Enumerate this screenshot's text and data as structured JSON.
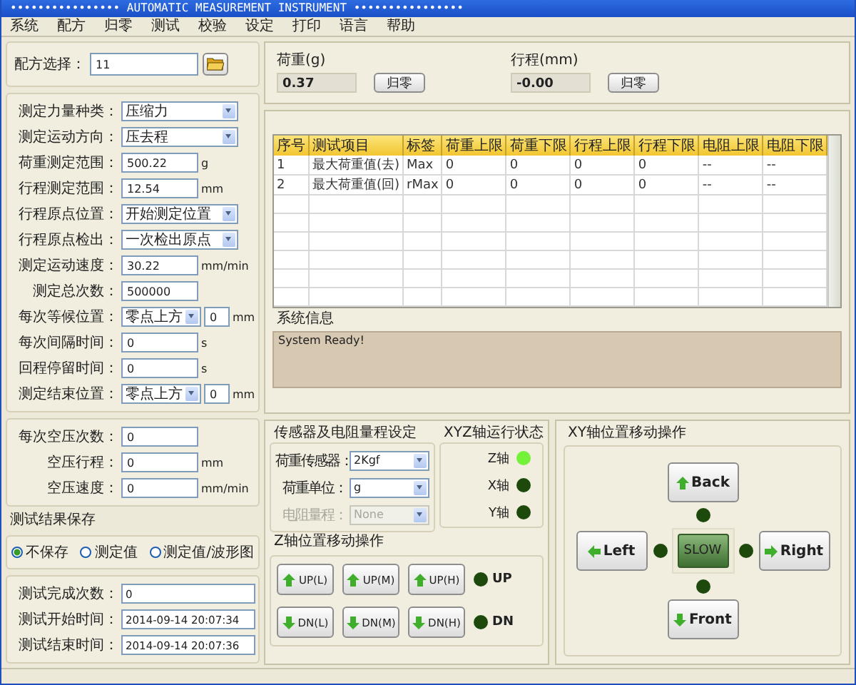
{
  "window": {
    "title": "•••••••••••••••• AUTOMATIC MEASUREMENT INSTRUMENT ••••••••••••••••"
  },
  "menu": [
    "系统",
    "配方",
    "归零",
    "测试",
    "校验",
    "设定",
    "打印",
    "语言",
    "帮助"
  ],
  "recipe": {
    "label": "配方选择：",
    "value": "11"
  },
  "params": [
    {
      "kind": "select",
      "label": "测定力量种类：",
      "value": "压缩力"
    },
    {
      "kind": "select",
      "label": "测定运动方向：",
      "value": "压去程"
    },
    {
      "kind": "input",
      "label": "荷重测定范围：",
      "value": "500.22",
      "unit": "g"
    },
    {
      "kind": "input",
      "label": "行程测定范围：",
      "value": "12.54",
      "unit": "mm"
    },
    {
      "kind": "select",
      "label": "行程原点位置：",
      "value": "开始测定位置"
    },
    {
      "kind": "select",
      "label": "行程原点检出：",
      "value": "一次检出原点"
    },
    {
      "kind": "input",
      "label": "测定运动速度：",
      "value": "30.22",
      "unit": "mm/min"
    },
    {
      "kind": "input",
      "label": "测定总次数：",
      "value": "500000"
    },
    {
      "kind": "combo",
      "label": "每次等候位置：",
      "value": "零点上方",
      "extra": "0",
      "unit": "mm"
    },
    {
      "kind": "input",
      "label": "每次间隔时间：",
      "value": "0",
      "unit": "s"
    },
    {
      "kind": "input",
      "label": "回程停留时间：",
      "value": "0",
      "unit": "s"
    },
    {
      "kind": "combo",
      "label": "测定结束位置：",
      "value": "零点上方",
      "extra": "0",
      "unit": "mm"
    }
  ],
  "air_press": [
    {
      "label": "每次空压次数：",
      "value": "0"
    },
    {
      "label": "空压行程：",
      "value": "0",
      "unit": "mm"
    },
    {
      "label": "空压速度：",
      "value": "0",
      "unit": "mm/min"
    }
  ],
  "save": {
    "title": "测试结果保存",
    "options": [
      {
        "label": "不保存",
        "selected": true
      },
      {
        "label": "测定值",
        "selected": false
      },
      {
        "label": "测定值/波形图",
        "selected": false
      }
    ]
  },
  "results": [
    {
      "label": "测试完成次数：",
      "value": "0"
    },
    {
      "label": "测试开始时间：",
      "value": "2014-09-14 20:07:34"
    },
    {
      "label": "测试结束时间：",
      "value": "2014-09-14 20:07:36"
    }
  ],
  "readouts": [
    {
      "label": "荷重(g)",
      "value": "0.37",
      "button": "归零"
    },
    {
      "label": "行程(mm)",
      "value": "-0.00",
      "button": "归零"
    }
  ],
  "table": {
    "columns": [
      "序号",
      "测试项目",
      "标签",
      "荷重上限",
      "荷重下限",
      "行程上限",
      "行程下限",
      "电阻上限",
      "电阻下限"
    ],
    "rows": [
      [
        "1",
        "最大荷重值(去)",
        "Max",
        "0",
        "0",
        "0",
        "0",
        "--",
        "--"
      ],
      [
        "2",
        "最大荷重值(回)",
        "rMax",
        "0",
        "0",
        "0",
        "0",
        "--",
        "--"
      ]
    ]
  },
  "system_info": {
    "title": "系统信息",
    "text": "System Ready!"
  },
  "sensor": {
    "title": "传感器及电阻量程设定",
    "fields": [
      {
        "label": "荷重传感器：",
        "value": "2Kgf",
        "disabled": false
      },
      {
        "label": "荷重单位：",
        "value": "g",
        "disabled": false
      },
      {
        "label": "电阻量程：",
        "value": "None",
        "disabled": true
      }
    ]
  },
  "axis_status": {
    "title": "XYZ轴运行状态",
    "axes": [
      {
        "label": "Z轴",
        "on": true
      },
      {
        "label": "X轴",
        "on": false
      },
      {
        "label": "Y轴",
        "on": false
      }
    ]
  },
  "z_move": {
    "title": "Z轴位置移动操作",
    "up": [
      "UP(L)",
      "UP(M)",
      "UP(H)"
    ],
    "down": [
      "DN(L)",
      "DN(M)",
      "DN(H)"
    ],
    "up_indicator": {
      "label": "UP",
      "on": false
    },
    "down_indicator": {
      "label": "DN",
      "on": false
    }
  },
  "xy_move": {
    "title": "XY轴位置移动操作",
    "back": {
      "label": "Back",
      "on": false
    },
    "left": {
      "label": "Left",
      "on": false
    },
    "right": {
      "label": "Right",
      "on": false
    },
    "front": {
      "label": "Front",
      "on": false
    },
    "center": "SLOW"
  }
}
